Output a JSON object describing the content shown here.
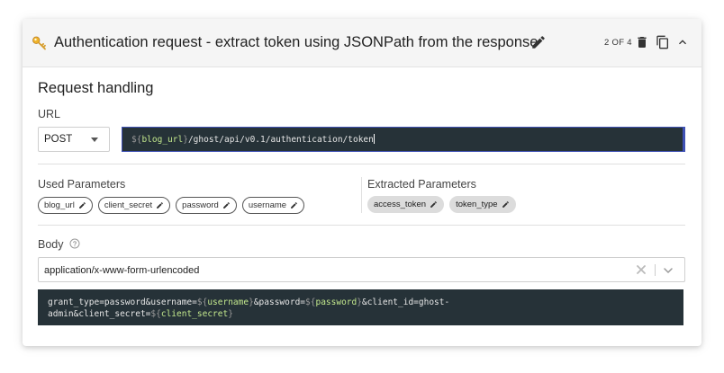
{
  "header": {
    "title": "Authentication request - extract token using JSONPath from the response",
    "step_counter": "2 OF 4"
  },
  "request": {
    "section_title": "Request handling",
    "url_label": "URL",
    "method": "POST",
    "url_prefix": "${",
    "url_var": "blog_url",
    "url_suffix_brace": "}",
    "url_path": "/ghost/api/v0.1/authentication/token"
  },
  "parameters": {
    "used_label": "Used Parameters",
    "used": [
      "blog_url",
      "client_secret",
      "password",
      "username"
    ],
    "extracted_label": "Extracted Parameters",
    "extracted": [
      "access_token",
      "token_type"
    ]
  },
  "body": {
    "label": "Body",
    "content_type": "application/x-www-form-urlencoded",
    "line1": [
      {
        "t": "grant_type=password&username=",
        "k": "text"
      },
      {
        "t": "${",
        "k": "brace"
      },
      {
        "t": "username",
        "k": "var"
      },
      {
        "t": "}",
        "k": "brace"
      },
      {
        "t": "&password=",
        "k": "text"
      },
      {
        "t": "${",
        "k": "brace"
      },
      {
        "t": "password",
        "k": "var"
      },
      {
        "t": "}",
        "k": "brace"
      },
      {
        "t": "&client_id=ghost-",
        "k": "text"
      }
    ],
    "line2": [
      {
        "t": "admin&client_secret=",
        "k": "text"
      },
      {
        "t": "${",
        "k": "brace"
      },
      {
        "t": "client_secret",
        "k": "var"
      },
      {
        "t": "}",
        "k": "brace"
      }
    ]
  },
  "colors": {
    "editor_bg": "#263238",
    "variable": "#c3e88d",
    "focus_border": "#3f51b5",
    "header_bg": "#f5f5f5"
  },
  "icons": [
    "key-icon",
    "pencil-icon",
    "trash-icon",
    "copy-icon",
    "chevron-up-icon",
    "help-icon",
    "clear-icon",
    "chevron-down-icon"
  ]
}
